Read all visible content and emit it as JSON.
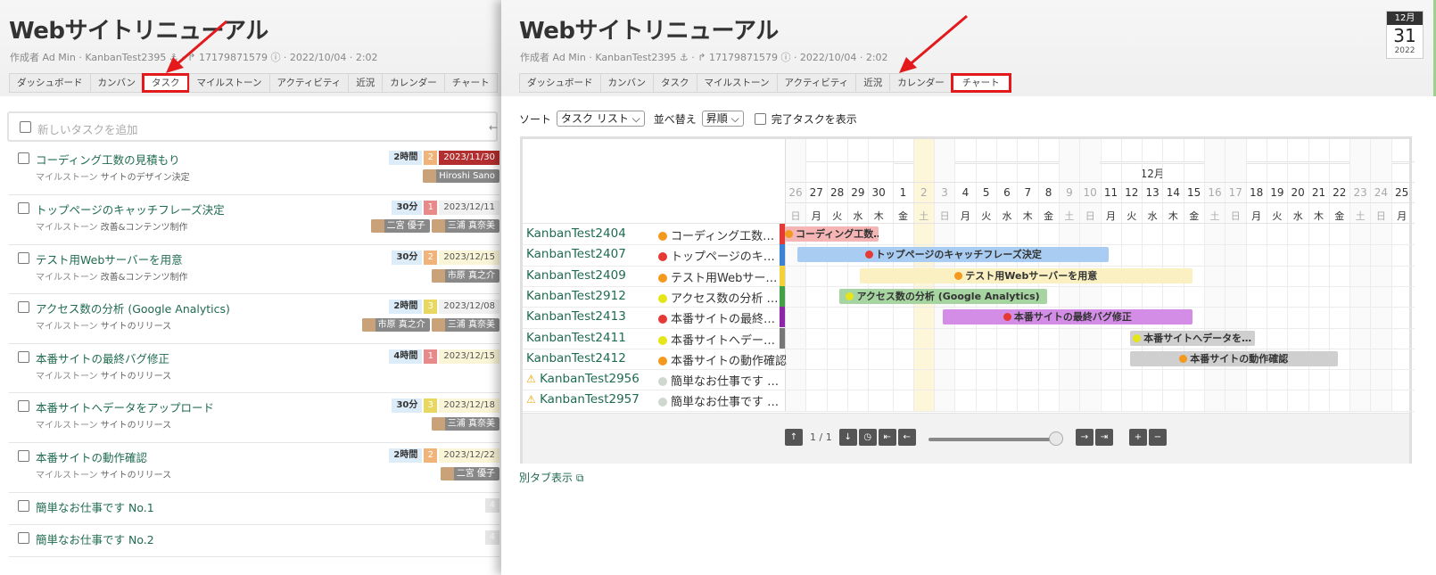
{
  "project": {
    "title": "Webサイトリニューアル",
    "meta_prefix": "作成者 Ad Min · KanbanTest2395 ⚓ · ↱ 17179871579 ⓘ · 2022/10/04 · 2:02"
  },
  "tabs": [
    "ダッシュボード",
    "カンバン",
    "タスク",
    "マイルストーン",
    "アクティビティ",
    "近況",
    "カレンダー",
    "チャート"
  ],
  "left": {
    "add_placeholder": "新しいタスクを追加",
    "add_mark": "←",
    "tasks": [
      {
        "name": "コーディング工数の見積もり",
        "milestone_label": "マイルストーン",
        "milestone": "サイトのデザイン決定",
        "estimate": "2時間",
        "priority": "2",
        "due": "2023/11/30",
        "users": [
          "Hiroshi Sano"
        ]
      },
      {
        "name": "トップページのキャッチフレーズ決定",
        "milestone_label": "マイルストーン",
        "milestone": "改善&コンテンツ制作",
        "estimate": "30分",
        "priority": "1",
        "due": "2023/12/11",
        "users": [
          "二宮 優子",
          "三浦 真奈美"
        ]
      },
      {
        "name": "テスト用Webサーバーを用意",
        "milestone_label": "マイルストーン",
        "milestone": "改善&コンテンツ制作",
        "estimate": "30分",
        "priority": "2",
        "due": "2023/12/15",
        "users": [
          "市原 真之介"
        ]
      },
      {
        "name": "アクセス数の分析 (Google Analytics)",
        "milestone_label": "マイルストーン",
        "milestone": "サイトのリリース",
        "estimate": "2時間",
        "priority": "3",
        "due": "2023/12/08",
        "users": [
          "市原 真之介",
          "三浦 真奈美"
        ]
      },
      {
        "name": "本番サイトの最終バグ修正",
        "milestone_label": "マイルストーン",
        "milestone": "サイトのリリース",
        "estimate": "4時間",
        "priority": "1",
        "due": "2023/12/15",
        "users": []
      },
      {
        "name": "本番サイトへデータをアップロード",
        "milestone_label": "マイルストーン",
        "milestone": "サイトのリリース",
        "estimate": "30分",
        "priority": "3",
        "due": "2023/12/18",
        "users": [
          "三浦 真奈美"
        ]
      },
      {
        "name": "本番サイトの動作確認",
        "milestone_label": "マイルストーン",
        "milestone": "サイトのリリース",
        "estimate": "2時間",
        "priority": "2",
        "due": "2023/12/22",
        "users": [
          "二宮 優子"
        ]
      },
      {
        "name": "簡単なお仕事です No.1",
        "num": "4"
      },
      {
        "name": "簡単なお仕事です No.2",
        "num": "4"
      }
    ]
  },
  "calendar": {
    "month": "12月",
    "day": "31",
    "year": "2022"
  },
  "toolbar": {
    "sort_label": "ソート",
    "sort_value": "タスク リスト",
    "order_label": "並べ替え",
    "order_value": "昇順",
    "show_done": "完了タスクを表示"
  },
  "gantt": {
    "month_label": "12月",
    "days": [
      {
        "n": "26",
        "w": "日"
      },
      {
        "n": "27",
        "w": "月"
      },
      {
        "n": "28",
        "w": "火"
      },
      {
        "n": "29",
        "w": "水"
      },
      {
        "n": "30",
        "w": "木"
      },
      {
        "n": "1",
        "w": "金"
      },
      {
        "n": "2",
        "w": "土"
      },
      {
        "n": "3",
        "w": "日"
      },
      {
        "n": "4",
        "w": "月"
      },
      {
        "n": "5",
        "w": "火"
      },
      {
        "n": "6",
        "w": "水"
      },
      {
        "n": "7",
        "w": "木"
      },
      {
        "n": "8",
        "w": "金"
      },
      {
        "n": "9",
        "w": "土"
      },
      {
        "n": "10",
        "w": "日"
      },
      {
        "n": "11",
        "w": "月"
      },
      {
        "n": "12",
        "w": "火"
      },
      {
        "n": "13",
        "w": "水"
      },
      {
        "n": "14",
        "w": "木"
      },
      {
        "n": "15",
        "w": "金"
      },
      {
        "n": "16",
        "w": "土"
      },
      {
        "n": "17",
        "w": "日"
      },
      {
        "n": "18",
        "w": "月"
      },
      {
        "n": "19",
        "w": "火"
      },
      {
        "n": "20",
        "w": "水"
      },
      {
        "n": "21",
        "w": "木"
      },
      {
        "n": "22",
        "w": "金"
      },
      {
        "n": "23",
        "w": "土"
      },
      {
        "n": "24",
        "w": "日"
      },
      {
        "n": "25",
        "w": "月"
      }
    ],
    "rows": [
      {
        "key": "KanbanTest2404",
        "task": "コーディング工数…",
        "dot": "#f39a1e",
        "strip": "#e53935",
        "bar": "コーディング工数…",
        "bar_color": "#f5b5b5",
        "start": 0,
        "end": 4.5
      },
      {
        "key": "KanbanTest2407",
        "task": "トップページのキ…",
        "dot": "#e53935",
        "strip": "#3b82d6",
        "bar": "トップページのキャッチフレーズ決定",
        "bar_color": "#a9cdf2",
        "start": 0.6,
        "end": 15.6
      },
      {
        "key": "KanbanTest2409",
        "task": "テスト用Webサー…",
        "dot": "#f39a1e",
        "strip": "#f4d13a",
        "bar": "テスト用Webサーバーを用意",
        "bar_color": "#fbf0c1",
        "start": 3.6,
        "end": 19.6
      },
      {
        "key": "KanbanTest2912",
        "task": "アクセス数の分析 …",
        "dot": "#e5e51a",
        "strip": "#43a047",
        "bar": "アクセス数の分析 (Google Analytics)",
        "bar_color": "#a6d5a1",
        "start": 2.6,
        "end": 12.6
      },
      {
        "key": "KanbanTest2413",
        "task": "本番サイトの最終…",
        "dot": "#e53935",
        "strip": "#8e24aa",
        "bar": "本番サイトの最終バグ修正",
        "bar_color": "#d38de6",
        "start": 7.6,
        "end": 19.6
      },
      {
        "key": "KanbanTest2411",
        "task": "本番サイトへデー…",
        "dot": "#e5e51a",
        "strip": "#777777",
        "bar": "本番サイトへデータを…",
        "bar_color": "#cfcfcf",
        "start": 16.6,
        "end": 22.6
      },
      {
        "key": "KanbanTest2412",
        "task": "本番サイトの動作確認",
        "dot": "#f39a1e",
        "strip": "",
        "bar": "本番サイトの動作確認",
        "bar_color": "#cfcfcf",
        "start": 16.6,
        "end": 26.6
      },
      {
        "key": "KanbanTest2956",
        "task": "簡単なお仕事です …",
        "dot": "#cfd8cf",
        "strip": "",
        "warn": "⚠",
        "bar": ""
      },
      {
        "key": "KanbanTest2957",
        "task": "簡単なお仕事です …",
        "dot": "#cfd8cf",
        "strip": "",
        "warn": "⚠",
        "bar": ""
      }
    ],
    "page": "1 / 1"
  },
  "other_tab": "別タブ表示"
}
